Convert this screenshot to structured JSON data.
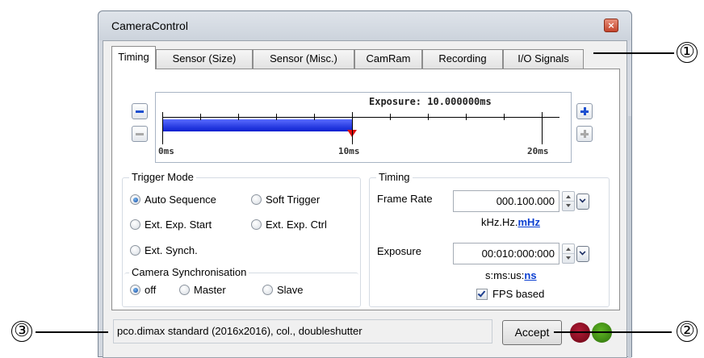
{
  "window": {
    "title": "CameraControl",
    "close_glyph": "×"
  },
  "tabs": [
    {
      "label": "Timing",
      "active": true
    },
    {
      "label": "Sensor (Size)",
      "active": false
    },
    {
      "label": "Sensor (Misc.)",
      "active": false
    },
    {
      "label": "CamRam",
      "active": false
    },
    {
      "label": "Recording",
      "active": false
    },
    {
      "label": "I/O Signals",
      "active": false
    }
  ],
  "timeline": {
    "exposure_label": "Exposure: 10.000000ms",
    "exposure_ms": 10,
    "range_ms": [
      0,
      20
    ],
    "tick_labels": [
      "0ms",
      "10ms",
      "20ms"
    ],
    "bar_color": "#1428d8",
    "marker_color": "#e01010",
    "buttons": {
      "decrease_large": "minus-icon",
      "decrease_small": "minus-icon",
      "increase_large": "plus-icon",
      "increase_small": "plus-icon"
    }
  },
  "trigger_mode": {
    "title": "Trigger Mode",
    "options": [
      {
        "label": "Auto Sequence",
        "selected": true
      },
      {
        "label": "Soft Trigger",
        "selected": false
      },
      {
        "label": "Ext. Exp. Start",
        "selected": false
      },
      {
        "label": "Ext. Exp. Ctrl",
        "selected": false
      },
      {
        "label": "Ext. Synch.",
        "selected": false
      }
    ]
  },
  "camera_sync": {
    "title": "Camera Synchronisation",
    "options": [
      {
        "label": "off",
        "selected": true
      },
      {
        "label": "Master",
        "selected": false
      },
      {
        "label": "Slave",
        "selected": false
      }
    ]
  },
  "timing": {
    "title": "Timing",
    "frame_rate": {
      "label": "Frame Rate",
      "value": "000.100.000",
      "units_prefix": "kHz.Hz.",
      "units_active": "mHz"
    },
    "exposure": {
      "label": "Exposure",
      "value": "00:010:000:000",
      "units_prefix": "s:ms:us:",
      "units_active": "ns"
    },
    "fps_based": {
      "label": "FPS based",
      "checked": true
    }
  },
  "status": {
    "camera_info": "pco.dimax standard (2016x2016), col., doubleshutter",
    "accept_label": "Accept",
    "indicators": [
      {
        "name": "status-led-red",
        "color": "#8b0a1e"
      },
      {
        "name": "status-led-green",
        "color": "#3e8e12"
      }
    ]
  },
  "callouts": [
    "①",
    "②",
    "③"
  ]
}
